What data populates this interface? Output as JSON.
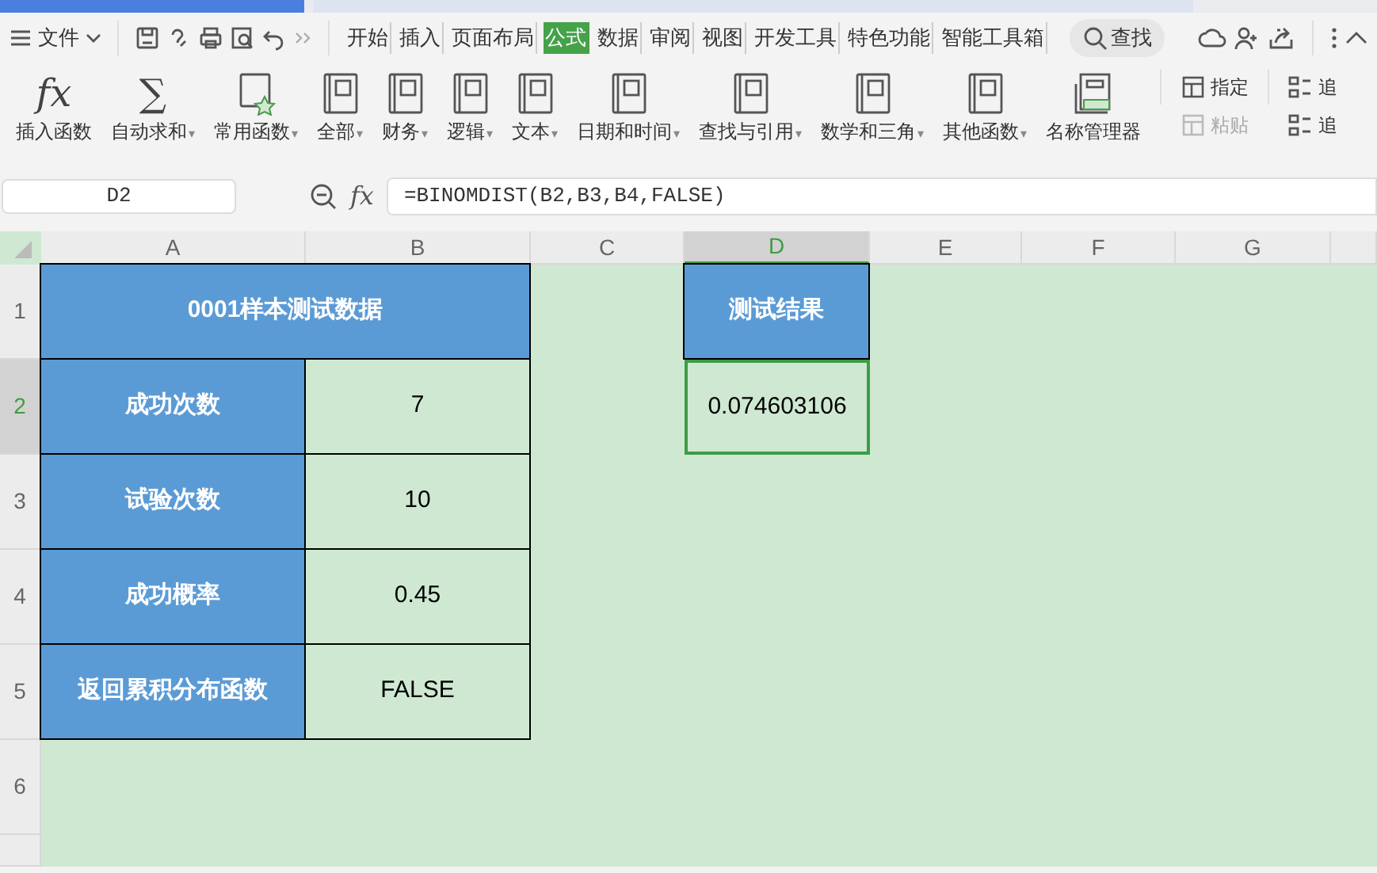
{
  "menu": {
    "file": "文件",
    "tabs": [
      {
        "label": "开始",
        "selected": false
      },
      {
        "label": "插入",
        "selected": false
      },
      {
        "label": "页面布局",
        "selected": false
      },
      {
        "label": "公式",
        "selected": true
      },
      {
        "label": "数据",
        "selected": false
      },
      {
        "label": "审阅",
        "selected": false
      },
      {
        "label": "视图",
        "selected": false
      },
      {
        "label": "开发工具",
        "selected": false
      },
      {
        "label": "特色功能",
        "selected": false
      },
      {
        "label": "智能工具箱",
        "selected": false
      }
    ],
    "search": "查找"
  },
  "ribbon": {
    "buttons": [
      {
        "kind": "fx",
        "glyph": "fx",
        "label": "插入函数"
      },
      {
        "kind": "sum",
        "glyph": "∑",
        "label": "自动求和",
        "caret": "▾"
      },
      {
        "kind": "star",
        "label": "常用函数",
        "caret": "▾"
      },
      {
        "kind": "book",
        "label": "全部",
        "caret": "▾"
      },
      {
        "kind": "book",
        "label": "财务",
        "caret": "▾"
      },
      {
        "kind": "book",
        "label": "逻辑",
        "caret": "▾"
      },
      {
        "kind": "book",
        "label": "文本",
        "caret": "▾"
      },
      {
        "kind": "book",
        "label": "日期和时间",
        "caret": "▾"
      },
      {
        "kind": "book",
        "label": "查找与引用",
        "caret": "▾"
      },
      {
        "kind": "book",
        "label": "数学和三角",
        "caret": "▾"
      },
      {
        "kind": "book",
        "label": "其他函数",
        "caret": "▾"
      },
      {
        "kind": "names",
        "label": "名称管理器"
      }
    ],
    "small": [
      {
        "label": "指定",
        "disabled": false
      },
      {
        "label": "粘贴",
        "disabled": true
      }
    ],
    "cut": [
      "追",
      "追"
    ]
  },
  "formula_bar": {
    "name_box": "D2",
    "fx": "fx",
    "formula": "=BINOMDIST(B2,B3,B4,FALSE)"
  },
  "sheet": {
    "columns": [
      {
        "label": "A",
        "selected": false
      },
      {
        "label": "B",
        "selected": false
      },
      {
        "label": "C",
        "selected": false
      },
      {
        "label": "D",
        "selected": true
      },
      {
        "label": "E",
        "selected": false
      },
      {
        "label": "F",
        "selected": false
      },
      {
        "label": "G",
        "selected": false
      }
    ],
    "rows": [
      {
        "label": "1",
        "selected": false,
        "cells": [
          {
            "kind": "header",
            "text": "0001样本测试数据",
            "selected": false
          },
          {
            "kind": "merged",
            "selected": false
          },
          {
            "kind": "empty",
            "selected": false
          },
          {
            "kind": "header",
            "text": "测试结果",
            "selected": false
          },
          {
            "kind": "empty",
            "selected": false
          },
          {
            "kind": "empty",
            "selected": false
          },
          {
            "kind": "empty",
            "selected": false
          }
        ]
      },
      {
        "label": "2",
        "selected": true,
        "cells": [
          {
            "kind": "header",
            "text": "成功次数",
            "selected": false
          },
          {
            "kind": "value",
            "text": "7",
            "selected": false
          },
          {
            "kind": "empty",
            "selected": false
          },
          {
            "kind": "result",
            "text": "0.074603106",
            "selected": true
          },
          {
            "kind": "empty",
            "selected": false
          },
          {
            "kind": "empty",
            "selected": false
          },
          {
            "kind": "empty",
            "selected": false
          }
        ]
      },
      {
        "label": "3",
        "selected": false,
        "cells": [
          {
            "kind": "header",
            "text": "试验次数",
            "selected": false
          },
          {
            "kind": "value",
            "text": "10",
            "selected": false
          },
          {
            "kind": "empty",
            "selected": false
          },
          {
            "kind": "empty",
            "selected": false
          },
          {
            "kind": "empty",
            "selected": false
          },
          {
            "kind": "empty",
            "selected": false
          },
          {
            "kind": "empty",
            "selected": false
          }
        ]
      },
      {
        "label": "4",
        "selected": false,
        "cells": [
          {
            "kind": "header",
            "text": "成功概率",
            "selected": false
          },
          {
            "kind": "value",
            "text": "0.45",
            "selected": false
          },
          {
            "kind": "empty",
            "selected": false
          },
          {
            "kind": "empty",
            "selected": false
          },
          {
            "kind": "empty",
            "selected": false
          },
          {
            "kind": "empty",
            "selected": false
          },
          {
            "kind": "empty",
            "selected": false
          }
        ]
      },
      {
        "label": "5",
        "selected": false,
        "cells": [
          {
            "kind": "header",
            "text": "返回累积分布函数",
            "selected": false
          },
          {
            "kind": "value",
            "text": "FALSE",
            "selected": false
          },
          {
            "kind": "empty",
            "selected": false
          },
          {
            "kind": "empty",
            "selected": false
          },
          {
            "kind": "empty",
            "selected": false
          },
          {
            "kind": "empty",
            "selected": false
          },
          {
            "kind": "empty",
            "selected": false
          }
        ]
      },
      {
        "label": "6",
        "selected": false,
        "cells": []
      }
    ]
  }
}
